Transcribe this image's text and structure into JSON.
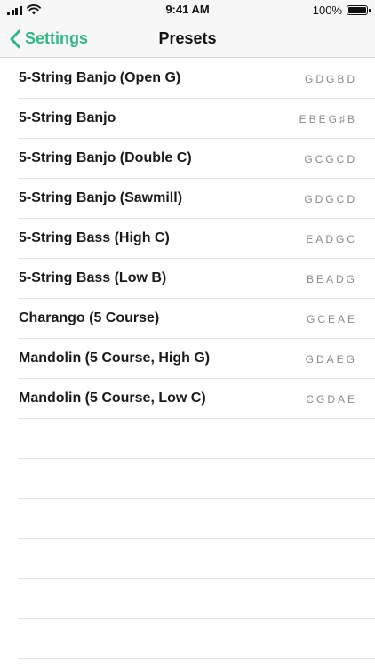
{
  "status_bar": {
    "time": "9:41 AM",
    "battery": "100%",
    "icons": [
      "signal-icon",
      "wifi-icon",
      "battery-icon"
    ]
  },
  "nav": {
    "back_label": "Settings",
    "title": "Presets",
    "back_icon": "chevron-left-icon"
  },
  "presets": [
    {
      "name": "5-String Banjo (Open G)",
      "tuning": "GDGBD"
    },
    {
      "name": "5-String Banjo",
      "tuning": "EBEG♯B"
    },
    {
      "name": "5-String Banjo (Double C)",
      "tuning": "GCGCD"
    },
    {
      "name": "5-String Banjo (Sawmill)",
      "tuning": "GDGCD"
    },
    {
      "name": "5-String Bass (High C)",
      "tuning": "EADGC"
    },
    {
      "name": "5-String Bass (Low B)",
      "tuning": "BEADG"
    },
    {
      "name": "Charango (5 Course)",
      "tuning": "GCEAE"
    },
    {
      "name": "Mandolin (5 Course, High G)",
      "tuning": "GDAEG"
    },
    {
      "name": "Mandolin (5 Course, Low C)",
      "tuning": "CGDAE"
    }
  ],
  "colors": {
    "accent": "#2fb886",
    "bar_background": "#f7f7f7",
    "separator": "#e4e4e4",
    "tuning_text": "#8a8a8a"
  }
}
